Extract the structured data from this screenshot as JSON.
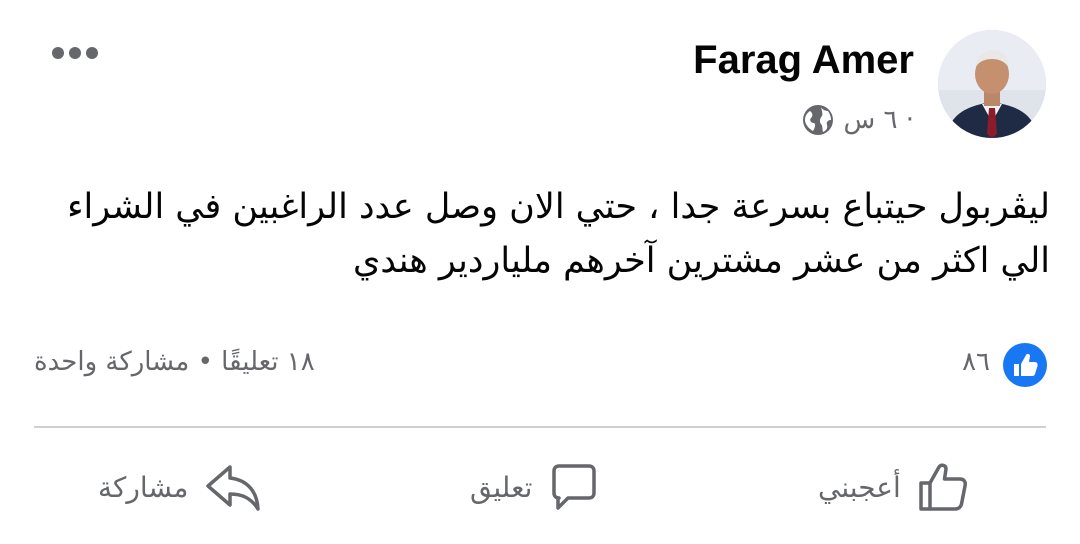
{
  "post": {
    "author": "Farag Amer",
    "time": "٦ س ·",
    "privacy_icon": "globe-icon",
    "body": "ليڤربول  حيتباع بسرعة جدا ، حتي الان وصل عدد الراغبين في الشراء الي اكثر من عشر مشترين آخرهم ملياردير هندي"
  },
  "reactions": {
    "count": "٨٦",
    "icon": "like-badge-icon",
    "stats": "١٨ تعليقًا • مشاركة واحدة"
  },
  "actions": {
    "like": "أعجبني",
    "comment": "تعليق",
    "share": "مشاركة"
  },
  "colors": {
    "text_primary": "#050505",
    "text_secondary": "#65676b",
    "like_blue": "#1877f2",
    "divider": "#ced0d4"
  }
}
